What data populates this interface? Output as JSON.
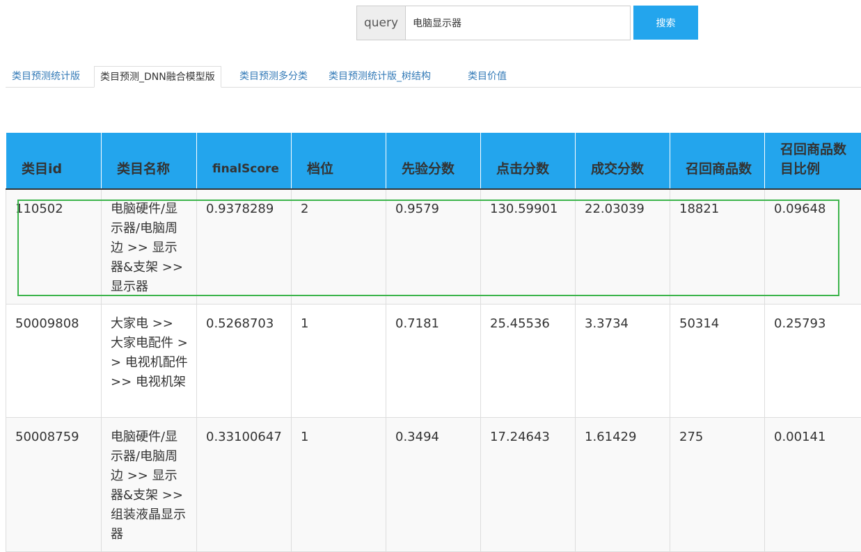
{
  "search": {
    "addon_label": "query",
    "value": "电脑显示器",
    "button_label": "搜索"
  },
  "tabs": [
    {
      "label": "类目预测统计版",
      "active": false
    },
    {
      "label": "类目预测_DNN融合模型版",
      "active": true
    },
    {
      "label": "类目预测多分类",
      "active": false
    },
    {
      "label": "类目预测统计版_树结构",
      "active": false
    },
    {
      "label": "类目价值",
      "active": false
    }
  ],
  "table": {
    "headers": [
      "类目id",
      "类目名称",
      "finalScore",
      "档位",
      "先验分数",
      "点击分数",
      "成交分数",
      "召回商品数",
      "召回商品数目比例"
    ],
    "rows": [
      [
        "110502",
        "电脑硬件/显示器/电脑周边 >> 显示器&支架 >> 显示器",
        "0.9378289",
        "2",
        "0.9579",
        "130.59901",
        "22.03039",
        "18821",
        "0.09648"
      ],
      [
        "50009808",
        "大家电 >> 大家电配件 >> 电视机配件 >> 电视机架",
        "0.5268703",
        "1",
        "0.7181",
        "25.45536",
        "3.3734",
        "50314",
        "0.25793"
      ],
      [
        "50008759",
        "电脑硬件/显示器/电脑周边 >> 显示器&支架 >> 组装液晶显示器",
        "0.33100647",
        "1",
        "0.3494",
        "17.24643",
        "1.61429",
        "275",
        "0.00141"
      ]
    ]
  },
  "colors": {
    "accent": "#23a5ed",
    "highlight": "#3cb44b"
  }
}
